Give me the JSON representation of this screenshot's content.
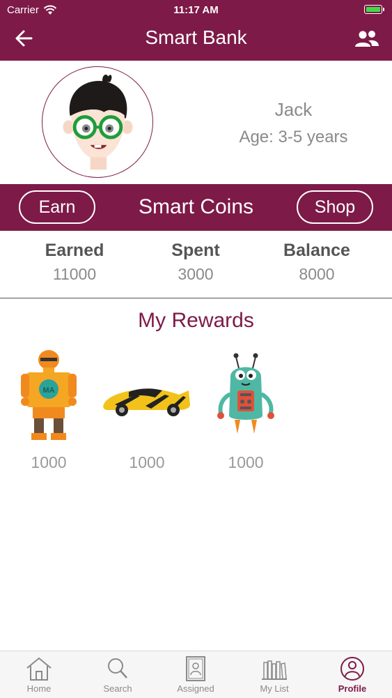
{
  "status_bar": {
    "carrier": "Carrier",
    "time": "11:17 AM"
  },
  "header": {
    "title": "Smart Bank",
    "back_icon": "arrow-left-icon",
    "people_icon": "users-icon"
  },
  "profile": {
    "name": "Jack",
    "age": "Age: 3-5 years"
  },
  "coins": {
    "title": "Smart Coins",
    "earn_label": "Earn",
    "shop_label": "Shop"
  },
  "stats": [
    {
      "label": "Earned",
      "value": "11000"
    },
    {
      "label": "Spent",
      "value": "3000"
    },
    {
      "label": "Balance",
      "value": "8000"
    }
  ],
  "rewards": {
    "title": "My Rewards",
    "items": [
      {
        "name": "orange robot",
        "price": "1000"
      },
      {
        "name": "race car",
        "price": "1000"
      },
      {
        "name": "green robot",
        "price": "1000"
      }
    ]
  },
  "tabs": [
    {
      "label": "Home",
      "icon": "home-icon",
      "active": false
    },
    {
      "label": "Search",
      "icon": "search-icon",
      "active": false
    },
    {
      "label": "Assigned",
      "icon": "assigned-icon",
      "active": false
    },
    {
      "label": "My List",
      "icon": "books-icon",
      "active": false
    },
    {
      "label": "Profile",
      "icon": "profile-icon",
      "active": true
    }
  ],
  "colors": {
    "brand": "#7d1a48",
    "text_gray": "#8a8a8a",
    "tab_active": "#7d1a48"
  }
}
